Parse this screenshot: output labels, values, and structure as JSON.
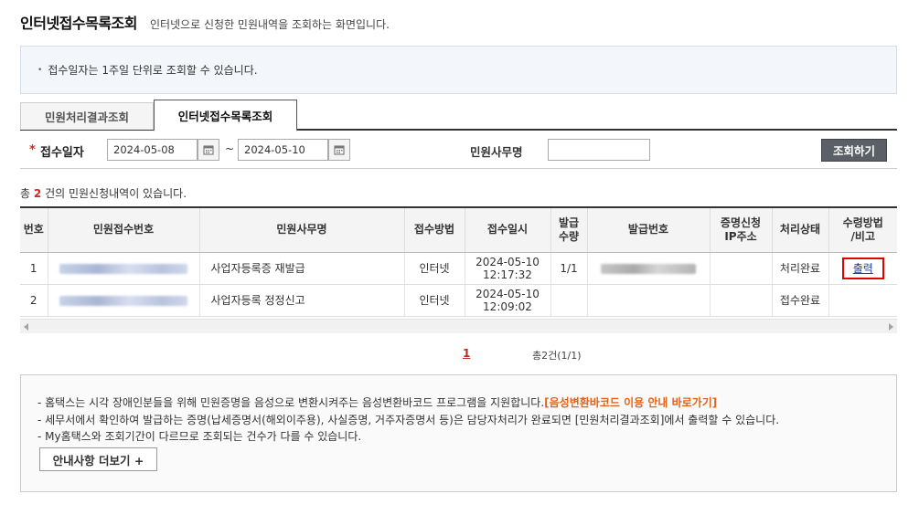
{
  "header": {
    "title": "인터넷접수목록조회",
    "description": "인터넷으로 신청한 민원내역을 조회하는 화면입니다."
  },
  "notice": {
    "bullet": "•",
    "text": "접수일자는 1주일 단위로 조회할 수 있습니다."
  },
  "tabs": [
    {
      "label": "민원처리결과조회",
      "active": false
    },
    {
      "label": "인터넷접수목록조회",
      "active": true
    }
  ],
  "search": {
    "required_mark": "*",
    "date_label": "접수일자",
    "start_date": "2024-05-08",
    "end_date": "2024-05-10",
    "separator": "~",
    "office_label": "민원사무명",
    "office_value": "",
    "button_label": "조회하기"
  },
  "result": {
    "prefix": "총",
    "count": "2",
    "suffix": "건의 민원신청내역이 있습니다."
  },
  "table": {
    "headers": [
      "번호",
      "민원접수번호",
      "민원사무명",
      "접수방법",
      "접수일시",
      "발급\n수량",
      "발급번호",
      "증명신청\nIP주소",
      "처리상태",
      "수령방법\n/비고"
    ],
    "rows": [
      {
        "no": "1",
        "office": "사업자등록증 재발급",
        "method": "인터넷",
        "date": "2024-05-10",
        "time": "12:17:32",
        "qty": "1/1",
        "status": "처리완료",
        "note": "출력"
      },
      {
        "no": "2",
        "office": "사업자등록 정정신고",
        "method": "인터넷",
        "date": "2024-05-10",
        "time": "12:09:02",
        "qty": "",
        "status": "접수완료",
        "note": ""
      }
    ]
  },
  "pagination": {
    "current": "1",
    "summary": "총2건(1/1)"
  },
  "info": {
    "line1": "- 홈택스는 시각 장애인분들을 위해 민원증명을 음성으로 변환시켜주는 음성변환바코드 프로그램을 지원합니다.",
    "line1_link": "[음성변환바코드 이용 안내 바로가기]",
    "line2": "- 세무서에서 확인하여 발급하는 증명(납세증명서(해외이주용), 사실증명, 거주자증명서 등)은 담당자처리가 완료되면 [민원처리결과조회]에서 출력할 수 있습니다.",
    "line3": "- My홈택스와 조회기간이 다르므로 조회되는 건수가 다를 수 있습니다.",
    "more_button": "안내사항 더보기 +"
  }
}
